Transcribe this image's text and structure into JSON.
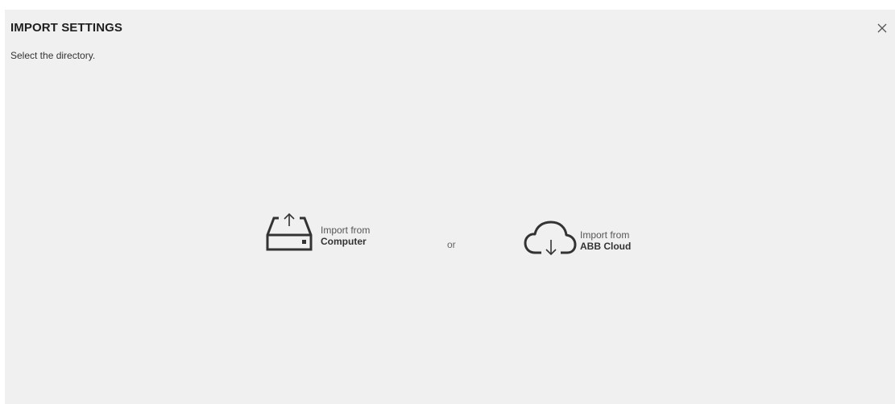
{
  "dialog": {
    "title": "IMPORT SETTINGS",
    "subtitle": "Select the directory.",
    "close_icon": "close-icon"
  },
  "options": {
    "computer": {
      "icon": "drive-upload-icon",
      "line1": "Import from",
      "line2": "Computer"
    },
    "separator": "or",
    "cloud": {
      "icon": "cloud-download-icon",
      "line1": "Import from",
      "line2": "ABB Cloud"
    }
  },
  "colors": {
    "dialog_bg": "#f0f0f0",
    "icon": "#333333"
  }
}
